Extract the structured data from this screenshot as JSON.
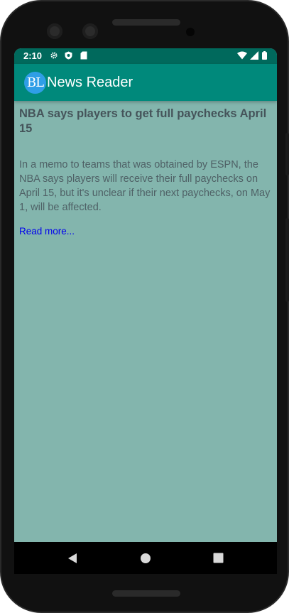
{
  "status_bar": {
    "time": "2:10",
    "left_icons": [
      "gear-icon",
      "shield-icon",
      "sd-card-icon"
    ],
    "right_icons": [
      "wifi-icon",
      "signal-icon",
      "battery-icon"
    ]
  },
  "app_bar": {
    "logo_text": "BL",
    "title": "News Reader",
    "color": "#00897b"
  },
  "article": {
    "headline": "NBA says players to get full paychecks April 15",
    "summary": "In a memo to teams that was obtained by ESPN, the NBA says players will receive their full paychecks on April 15, but it's unclear if their next paychecks, on May 1, will be affected.",
    "read_more": "Read more..."
  },
  "nav_bar": {
    "buttons": [
      "back-icon",
      "home-icon",
      "recents-icon"
    ]
  },
  "colors": {
    "status_bar": "#00695c",
    "background": "#83b5ad",
    "link": "#0000ee"
  }
}
